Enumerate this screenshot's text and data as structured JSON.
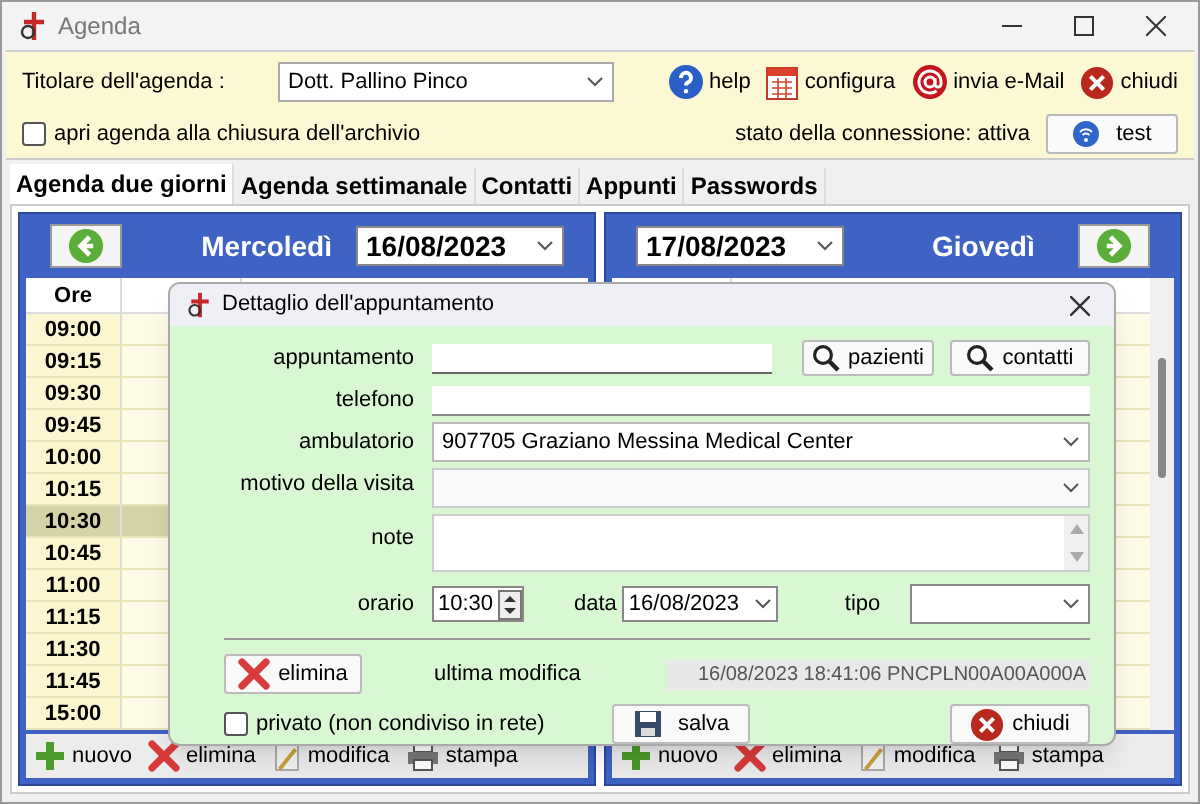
{
  "window": {
    "title": "Agenda"
  },
  "owner": {
    "label": "Titolare dell'agenda :",
    "value": "Dott. Pallino Pinco"
  },
  "actions": [
    {
      "kind": "help",
      "label": "help"
    },
    {
      "kind": "calendar",
      "label": "configura"
    },
    {
      "kind": "mail",
      "label": "invia e-Mail"
    },
    {
      "kind": "close",
      "label": "chiudi"
    }
  ],
  "open_on_close": {
    "label": "apri agenda alla chiusura dell'archivio",
    "checked": false
  },
  "connection": {
    "status": "stato della connessione: attiva",
    "test_button": "test"
  },
  "tabs": [
    {
      "label": "Agenda due giorni",
      "selected": true
    },
    {
      "label": "Agenda settimanale",
      "selected": false
    },
    {
      "label": "Contatti",
      "selected": false
    },
    {
      "label": "Appunti",
      "selected": false
    },
    {
      "label": "Passwords",
      "selected": false
    }
  ],
  "days": [
    {
      "kind": "prev",
      "day": "Mercoledì",
      "date": "16/08/2023",
      "hours_header": "Ore",
      "times": [
        {
          "label": "09:00",
          "selected": false
        },
        {
          "label": "09:15",
          "selected": false
        },
        {
          "label": "09:30",
          "selected": false
        },
        {
          "label": "09:45",
          "selected": false
        },
        {
          "label": "10:00",
          "selected": false
        },
        {
          "label": "10:15",
          "selected": false
        },
        {
          "label": "10:30",
          "selected": true
        },
        {
          "label": "10:45",
          "selected": false
        },
        {
          "label": "11:00",
          "selected": false
        },
        {
          "label": "11:15",
          "selected": false
        },
        {
          "label": "11:30",
          "selected": false
        },
        {
          "label": "11:45",
          "selected": false
        },
        {
          "label": "15:00",
          "selected": false
        }
      ],
      "toolbar": [
        {
          "kind": "add",
          "label": "nuovo"
        },
        {
          "kind": "delete",
          "label": "elimina"
        },
        {
          "kind": "edit",
          "label": "modifica"
        },
        {
          "kind": "print",
          "label": "stampa"
        }
      ]
    },
    {
      "kind": "next",
      "day": "Giovedì",
      "date": "17/08/2023",
      "toolbar": [
        {
          "kind": "add",
          "label": "nuovo"
        },
        {
          "kind": "delete",
          "label": "elimina"
        },
        {
          "kind": "edit",
          "label": "modifica"
        },
        {
          "kind": "print",
          "label": "stampa"
        }
      ]
    }
  ],
  "dialog": {
    "title": "Dettaglio dell'appuntamento",
    "appointment_label": "appuntamento",
    "patients_button": "pazienti",
    "contacts_button": "contatti",
    "phone_label": "telefono",
    "clinic_label": "ambulatorio",
    "clinic_value": "907705 Graziano Messina Medical Center",
    "reason_label": "motivo della visita",
    "notes_label": "note",
    "time_label": "orario",
    "time_value": "10:30",
    "date_label": "data",
    "date_value": "16/08/2023",
    "type_label": "tipo",
    "delete_button": "elimina",
    "last_modified_label": "ultima modifica",
    "last_modified_value": "16/08/2023 18:41:06 PNCPLN00A00A000A",
    "private": {
      "label": "privato (non condiviso in rete)",
      "checked": false
    },
    "save_button": "salva",
    "close_button": "chiudi"
  }
}
